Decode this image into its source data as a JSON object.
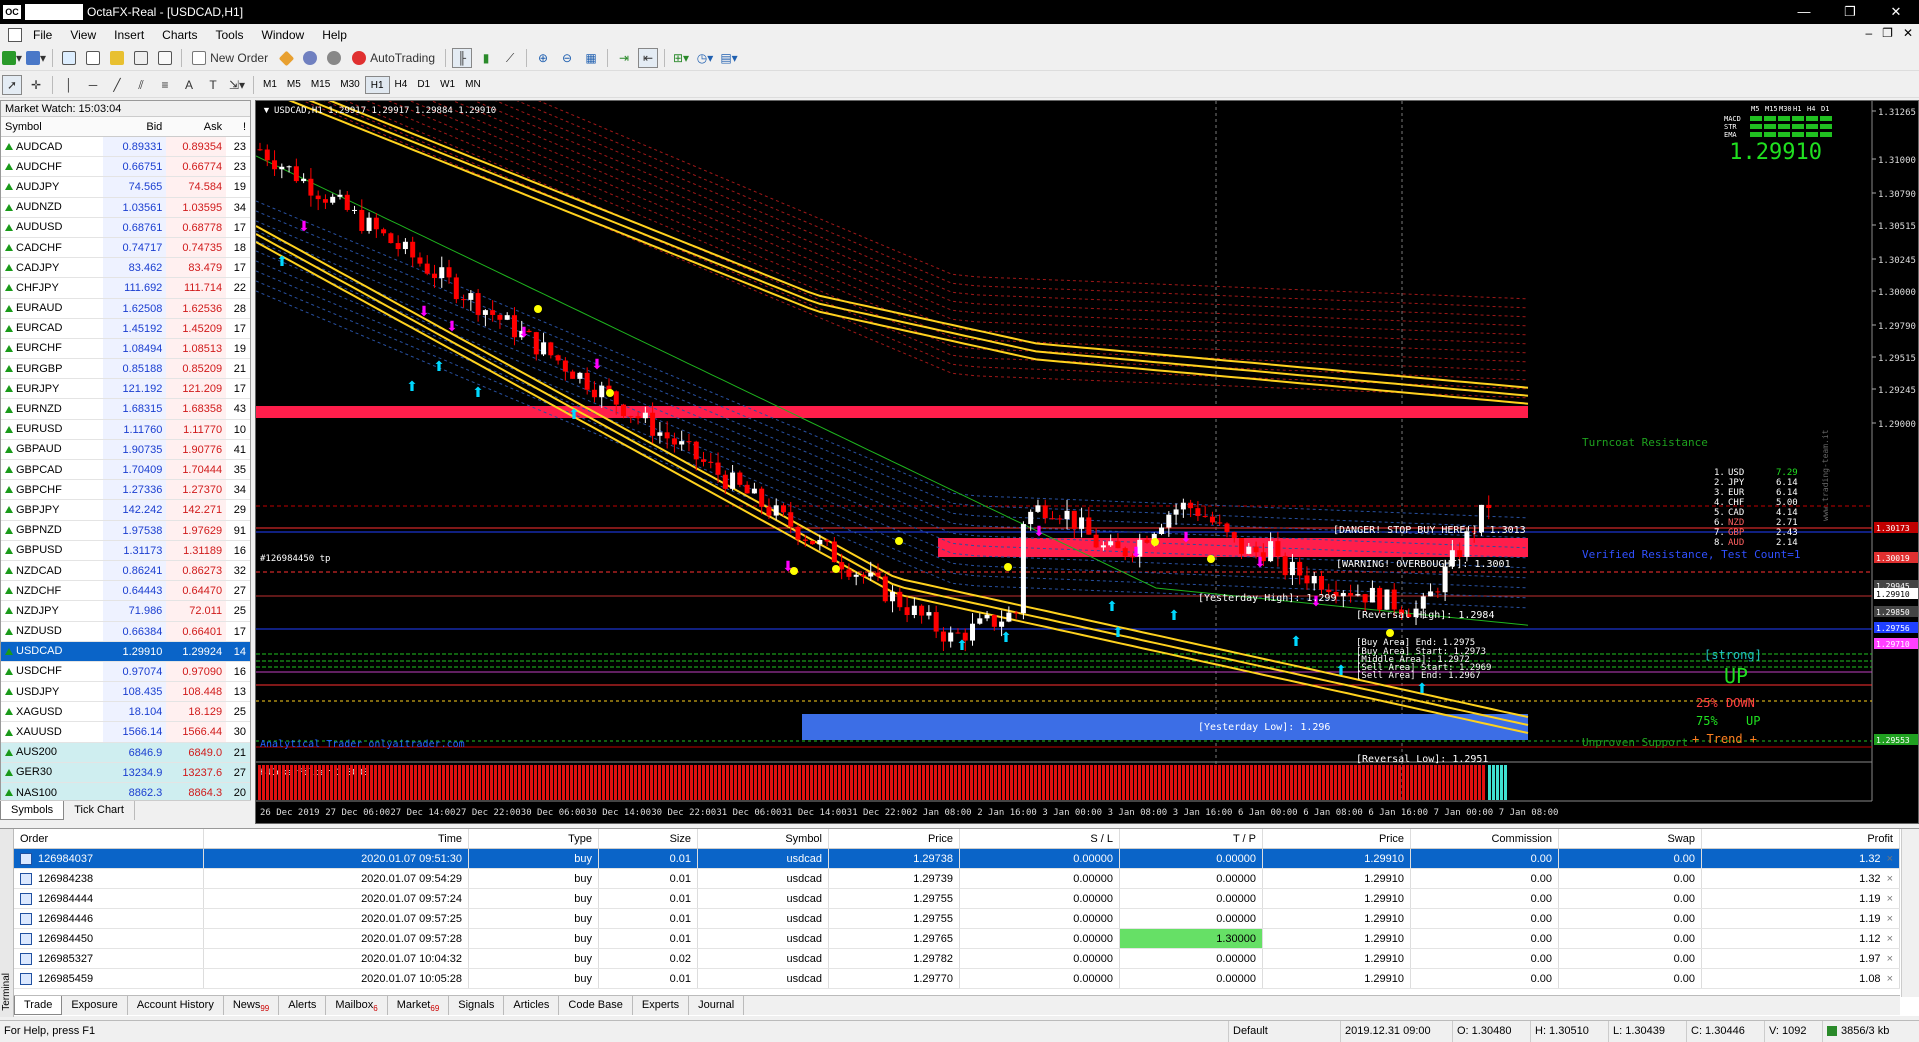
{
  "titlebar": {
    "app_icon": "OC",
    "title": "OctaFX-Real - [USDCAD,H1]",
    "min": "—",
    "restore": "❐",
    "close": "✕"
  },
  "menu": {
    "items": [
      "File",
      "View",
      "Insert",
      "Charts",
      "Tools",
      "Window",
      "Help"
    ]
  },
  "toolbar": {
    "new_order": "New Order",
    "autotrading": "AutoTrading",
    "timeframes": [
      "M1",
      "M5",
      "M15",
      "M30",
      "H1",
      "H4",
      "D1",
      "W1",
      "MN"
    ],
    "active_timeframe": "H1"
  },
  "market_watch": {
    "title": "Market Watch: 15:03:04",
    "columns": {
      "symbol": "Symbol",
      "bid": "Bid",
      "ask": "Ask",
      "spread": "!"
    },
    "rows": [
      {
        "symbol": "AUDCAD",
        "bid": "0.89331",
        "ask": "0.89354",
        "spread": "23"
      },
      {
        "symbol": "AUDCHF",
        "bid": "0.66751",
        "ask": "0.66774",
        "spread": "23"
      },
      {
        "symbol": "AUDJPY",
        "bid": "74.565",
        "ask": "74.584",
        "spread": "19"
      },
      {
        "symbol": "AUDNZD",
        "bid": "1.03561",
        "ask": "1.03595",
        "spread": "34"
      },
      {
        "symbol": "AUDUSD",
        "bid": "0.68761",
        "ask": "0.68778",
        "spread": "17"
      },
      {
        "symbol": "CADCHF",
        "bid": "0.74717",
        "ask": "0.74735",
        "spread": "18"
      },
      {
        "symbol": "CADJPY",
        "bid": "83.462",
        "ask": "83.479",
        "spread": "17"
      },
      {
        "symbol": "CHFJPY",
        "bid": "111.692",
        "ask": "111.714",
        "spread": "22"
      },
      {
        "symbol": "EURAUD",
        "bid": "1.62508",
        "ask": "1.62536",
        "spread": "28"
      },
      {
        "symbol": "EURCAD",
        "bid": "1.45192",
        "ask": "1.45209",
        "spread": "17"
      },
      {
        "symbol": "EURCHF",
        "bid": "1.08494",
        "ask": "1.08513",
        "spread": "19"
      },
      {
        "symbol": "EURGBP",
        "bid": "0.85188",
        "ask": "0.85209",
        "spread": "21"
      },
      {
        "symbol": "EURJPY",
        "bid": "121.192",
        "ask": "121.209",
        "spread": "17"
      },
      {
        "symbol": "EURNZD",
        "bid": "1.68315",
        "ask": "1.68358",
        "spread": "43"
      },
      {
        "symbol": "EURUSD",
        "bid": "1.11760",
        "ask": "1.11770",
        "spread": "10"
      },
      {
        "symbol": "GBPAUD",
        "bid": "1.90735",
        "ask": "1.90776",
        "spread": "41"
      },
      {
        "symbol": "GBPCAD",
        "bid": "1.70409",
        "ask": "1.70444",
        "spread": "35"
      },
      {
        "symbol": "GBPCHF",
        "bid": "1.27336",
        "ask": "1.27370",
        "spread": "34"
      },
      {
        "symbol": "GBPJPY",
        "bid": "142.242",
        "ask": "142.271",
        "spread": "29"
      },
      {
        "symbol": "GBPNZD",
        "bid": "1.97538",
        "ask": "1.97629",
        "spread": "91"
      },
      {
        "symbol": "GBPUSD",
        "bid": "1.31173",
        "ask": "1.31189",
        "spread": "16"
      },
      {
        "symbol": "NZDCAD",
        "bid": "0.86241",
        "ask": "0.86273",
        "spread": "32"
      },
      {
        "symbol": "NZDCHF",
        "bid": "0.64443",
        "ask": "0.64470",
        "spread": "27"
      },
      {
        "symbol": "NZDJPY",
        "bid": "71.986",
        "ask": "72.011",
        "spread": "25"
      },
      {
        "symbol": "NZDUSD",
        "bid": "0.66384",
        "ask": "0.66401",
        "spread": "17"
      },
      {
        "symbol": "USDCAD",
        "bid": "1.29910",
        "ask": "1.29924",
        "spread": "14"
      },
      {
        "symbol": "USDCHF",
        "bid": "0.97074",
        "ask": "0.97090",
        "spread": "16"
      },
      {
        "symbol": "USDJPY",
        "bid": "108.435",
        "ask": "108.448",
        "spread": "13"
      },
      {
        "symbol": "XAGUSD",
        "bid": "18.104",
        "ask": "18.129",
        "spread": "25"
      },
      {
        "symbol": "XAUUSD",
        "bid": "1566.14",
        "ask": "1566.44",
        "spread": "30"
      },
      {
        "symbol": "AUS200",
        "bid": "6846.9",
        "ask": "6849.0",
        "spread": "21"
      },
      {
        "symbol": "GER30",
        "bid": "13234.9",
        "ask": "13237.6",
        "spread": "27"
      },
      {
        "symbol": "NAS100",
        "bid": "8862.3",
        "ask": "8864.3",
        "spread": "20"
      }
    ],
    "selected_symbol": "USDCAD",
    "tabs": [
      "Symbols",
      "Tick Chart"
    ]
  },
  "chart": {
    "header": "USDCAD,H1  1.29917 1.29917 1.29884 1.29910",
    "price_big": "1.29910",
    "price_axis": [
      "1.31265",
      "1.31000",
      "1.30790",
      "1.30515",
      "1.30245",
      "1.30000",
      "1.29790",
      "1.29515",
      "1.29245",
      "1.29000"
    ],
    "price_axis_all": [
      "1.31265",
      "1.31000",
      "1.30790",
      "1.30515",
      "1.30245",
      "1.30000",
      "1.29790",
      "1.29515",
      "1.29245",
      "1.29000"
    ],
    "time_axis": [
      "26 Dec 2019",
      "27 Dec 06:00",
      "27 Dec 14:00",
      "27 Dec 22:00",
      "30 Dec 06:00",
      "30 Dec 14:00",
      "30 Dec 22:00",
      "31 Dec 06:00",
      "31 Dec 14:00",
      "31 Dec 22:00",
      "2 Jan 08:00",
      "2 Jan 16:00",
      "3 Jan 00:00",
      "3 Jan 08:00",
      "3 Jan 16:00",
      "6 Jan 00:00",
      "6 Jan 08:00",
      "6 Jan 16:00",
      "7 Jan 00:00",
      "7 Jan 08:00"
    ],
    "annotations": {
      "turncoat": "Turncoat Resistance",
      "danger": "[DANGER! STOP BUY HERE!]: 1.3013",
      "warning": "[WARNING! OVERBOUGHT]: 1.3001",
      "verified": "Verified Resistance, Test Count=1",
      "yesterday_high": "[Yesterday High]: 1.299",
      "reversal_high": "[Reversal High]: 1.2984",
      "buy_area_end": "[Buy Area] End: 1.2975",
      "buy_area_start": "[Buy Area] Start: 1.2973",
      "middle_area": "[Middle Area]: 1.2972",
      "sell_area_start": "[Sell Area] Start: 1.2969",
      "sell_area_end": "[Sell Area] End: 1.2967",
      "yesterday_low": "[Yesterday Low]: 1.296",
      "reversal_low": "[Reversal Low]: 1.2951",
      "unproven": "Unproven Support",
      "tp_label": "#126984450 tp",
      "watermark": "Analytical Trader onlyaitrader.com",
      "indicator": "H4JokerFilter 1.0000",
      "strong": "[strong]",
      "up": "UP",
      "pct_down": "25%",
      "down_word": "DOWN",
      "pct_up": "75%",
      "up_word": "UP",
      "trend": "+  Trend  +",
      "mtf_labels": [
        "M5",
        "M15",
        "M30",
        "H1",
        "H4",
        "D1"
      ],
      "mtf_rows": [
        "MACD",
        "STR",
        "EMA"
      ],
      "site": "www.trading-team.it"
    },
    "strength": [
      {
        "rank": "1.",
        "cur": "USD",
        "val": "7.29"
      },
      {
        "rank": "2.",
        "cur": "JPY",
        "val": "6.14"
      },
      {
        "rank": "3.",
        "cur": "EUR",
        "val": "6.14"
      },
      {
        "rank": "4.",
        "cur": "CHF",
        "val": "5.00"
      },
      {
        "rank": "5.",
        "cur": "CAD",
        "val": "4.14"
      },
      {
        "rank": "6.",
        "cur": "NZD",
        "val": "2.71"
      },
      {
        "rank": "7.",
        "cur": "GBP",
        "val": "2.43"
      },
      {
        "rank": "8.",
        "cur": "AUD",
        "val": "2.14"
      }
    ],
    "price_tags": [
      "1.30173",
      "1.30019",
      "1.29945",
      "1.29910",
      "1.29850",
      "1.29756",
      "1.29710",
      "1.29553"
    ]
  },
  "terminal": {
    "side_label": "Terminal",
    "columns": [
      "Order",
      "Time",
      "Type",
      "Size",
      "Symbol",
      "Price",
      "S / L",
      "T / P",
      "Price",
      "Commission",
      "Swap",
      "Profit"
    ],
    "rows": [
      {
        "order": "126984037",
        "time": "2020.01.07 09:51:30",
        "type": "buy",
        "size": "0.01",
        "symbol": "usdcad",
        "price": "1.29738",
        "sl": "0.00000",
        "tp": "0.00000",
        "cprice": "1.29910",
        "comm": "0.00",
        "swap": "0.00",
        "profit": "1.32",
        "tp_hl": false
      },
      {
        "order": "126984238",
        "time": "2020.01.07 09:54:29",
        "type": "buy",
        "size": "0.01",
        "symbol": "usdcad",
        "price": "1.29739",
        "sl": "0.00000",
        "tp": "0.00000",
        "cprice": "1.29910",
        "comm": "0.00",
        "swap": "0.00",
        "profit": "1.32",
        "tp_hl": false
      },
      {
        "order": "126984444",
        "time": "2020.01.07 09:57:24",
        "type": "buy",
        "size": "0.01",
        "symbol": "usdcad",
        "price": "1.29755",
        "sl": "0.00000",
        "tp": "0.00000",
        "cprice": "1.29910",
        "comm": "0.00",
        "swap": "0.00",
        "profit": "1.19",
        "tp_hl": false
      },
      {
        "order": "126984446",
        "time": "2020.01.07 09:57:25",
        "type": "buy",
        "size": "0.01",
        "symbol": "usdcad",
        "price": "1.29755",
        "sl": "0.00000",
        "tp": "0.00000",
        "cprice": "1.29910",
        "comm": "0.00",
        "swap": "0.00",
        "profit": "1.19",
        "tp_hl": false
      },
      {
        "order": "126984450",
        "time": "2020.01.07 09:57:28",
        "type": "buy",
        "size": "0.01",
        "symbol": "usdcad",
        "price": "1.29765",
        "sl": "0.00000",
        "tp": "1.30000",
        "cprice": "1.29910",
        "comm": "0.00",
        "swap": "0.00",
        "profit": "1.12",
        "tp_hl": true
      },
      {
        "order": "126985327",
        "time": "2020.01.07 10:04:32",
        "type": "buy",
        "size": "0.02",
        "symbol": "usdcad",
        "price": "1.29782",
        "sl": "0.00000",
        "tp": "0.00000",
        "cprice": "1.29910",
        "comm": "0.00",
        "swap": "0.00",
        "profit": "1.97",
        "tp_hl": false
      },
      {
        "order": "126985459",
        "time": "2020.01.07 10:05:28",
        "type": "buy",
        "size": "0.01",
        "symbol": "usdcad",
        "price": "1.29770",
        "sl": "0.00000",
        "tp": "0.00000",
        "cprice": "1.29910",
        "comm": "0.00",
        "swap": "0.00",
        "profit": "1.08",
        "tp_hl": false
      }
    ],
    "tabs": [
      {
        "label": "Trade",
        "badge": ""
      },
      {
        "label": "Exposure",
        "badge": ""
      },
      {
        "label": "Account History",
        "badge": ""
      },
      {
        "label": "News",
        "badge": "99"
      },
      {
        "label": "Alerts",
        "badge": ""
      },
      {
        "label": "Mailbox",
        "badge": "6"
      },
      {
        "label": "Market",
        "badge": "69"
      },
      {
        "label": "Signals",
        "badge": ""
      },
      {
        "label": "Articles",
        "badge": ""
      },
      {
        "label": "Code Base",
        "badge": ""
      },
      {
        "label": "Experts",
        "badge": ""
      },
      {
        "label": "Journal",
        "badge": ""
      }
    ]
  },
  "statusbar": {
    "help": "For Help, press F1",
    "profile": "Default",
    "datetime": "2019.12.31 09:00",
    "open": "O: 1.30480",
    "high": "H: 1.30510",
    "low": "L: 1.30439",
    "close": "C: 1.30446",
    "volume": "V: 1092",
    "traffic": "3856/3 kb"
  },
  "colors": {
    "bull": "#ffffff",
    "bear": "#ff0000",
    "danger_zone": "#ff1e4b",
    "support_zone": "#3c6ee6",
    "band_yellow": "#ffd21e",
    "green_ma": "#1eb41e"
  }
}
